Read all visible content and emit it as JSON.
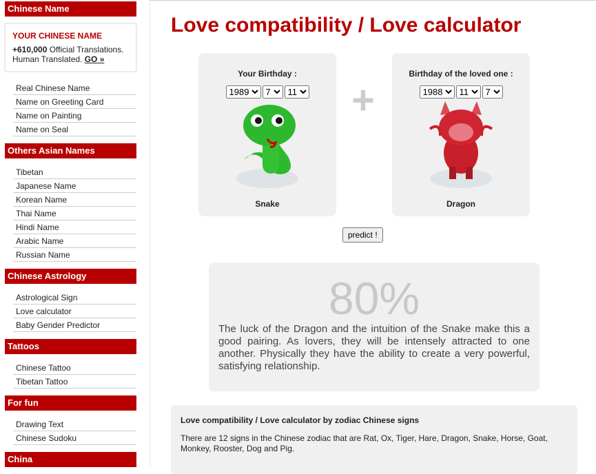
{
  "sidebar": {
    "sections": [
      {
        "title": "Chinese Name",
        "items": [
          "Real Chinese Name",
          "Name on Greeting Card",
          "Name on Painting",
          "Name on Seal"
        ]
      },
      {
        "title": "Others Asian Names",
        "items": [
          "Tibetan",
          "Japanese Name",
          "Korean Name",
          "Thai Name",
          "Hindi Name",
          "Arabic Name",
          "Russian Name"
        ]
      },
      {
        "title": "Chinese Astrology",
        "items": [
          "Astrological Sign",
          "Love calculator",
          "Baby Gender Predictor"
        ]
      },
      {
        "title": "Tattoos",
        "items": [
          "Chinese Tattoo",
          "Tibetan Tattoo"
        ]
      },
      {
        "title": "For fun",
        "items": [
          "Drawing Text",
          "Chinese Sudoku"
        ]
      },
      {
        "title": "China",
        "items": []
      }
    ],
    "promo": {
      "title": "YOUR CHINESE NAME",
      "count": "+610,000",
      "text1": " Official Translations.",
      "text2": "Human Translated. ",
      "go": "GO »"
    }
  },
  "main": {
    "title": "Love compatibility / Love calculator",
    "you": {
      "label": "Your Birthday :",
      "year": "1989",
      "month": "7",
      "day": "11",
      "sign": "Snake"
    },
    "loved": {
      "label": "Birthday of the loved one :",
      "year": "1988",
      "month": "11",
      "day": "7",
      "sign": "Dragon"
    },
    "plus": "+",
    "predict": "predict !",
    "result": {
      "percent": "80%",
      "text": "The luck of the Dragon and the intuition of the Snake make this a good pairing. As lovers, they will be intensely attracted to one another. Physically they have the ability to create a very powerful, satisfying relationship."
    },
    "info": {
      "title": "Love compatibility / Love calculator by zodiac Chinese signs",
      "p1": "There are 12 signs in the Chinese zodiac that are Rat, Ox, Tiger, Hare, Dragon, Snake, Horse, Goat, Monkey, Rooster, Dog and Pig."
    }
  },
  "colors": {
    "accent": "#b80000",
    "panel": "#f0f0f0",
    "snake": "#2db82d",
    "dragon": "#c8202a"
  }
}
